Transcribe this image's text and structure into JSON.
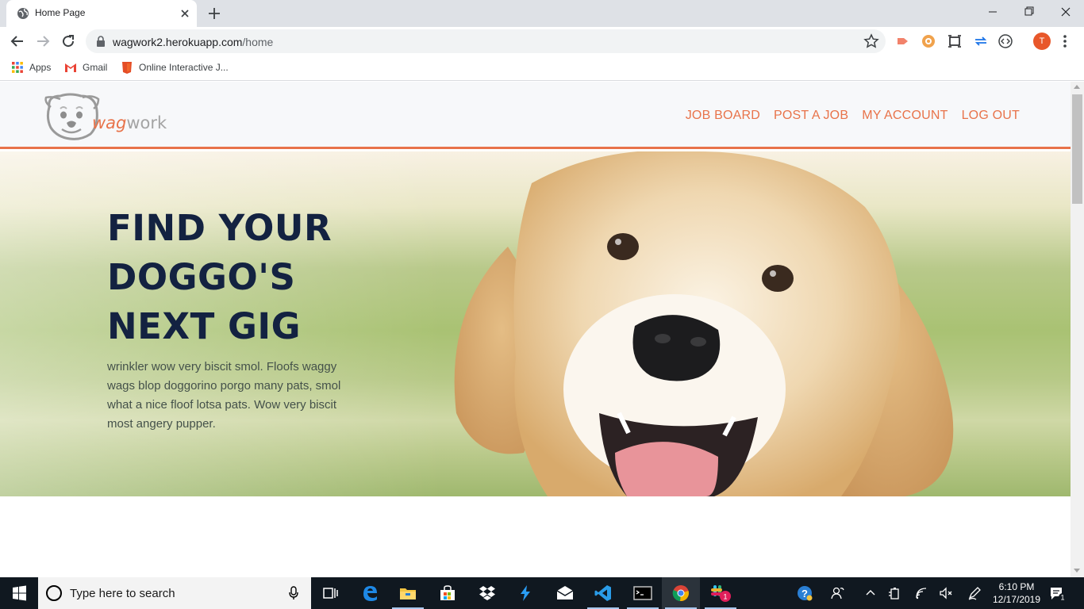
{
  "browser": {
    "tab_title": "Home Page",
    "url_host": "wagwork2.herokuapp.com",
    "url_path": "/home",
    "profile_initial": "T",
    "bookmarks": [
      {
        "label": "Apps",
        "icon": "apps-grid-icon"
      },
      {
        "label": "Gmail",
        "icon": "gmail-icon"
      },
      {
        "label": "Online Interactive J...",
        "icon": "html5-icon"
      }
    ]
  },
  "site": {
    "logo_wag": "wag",
    "logo_work": "work",
    "nav": [
      "JOB BOARD",
      "POST A JOB",
      "MY ACCOUNT",
      "LOG OUT"
    ],
    "hero_title": "FIND YOUR DOGGO'S NEXT GIG",
    "hero_text": "wrinkler wow very biscit smol. Floofs waggy wags blop doggorino porgo many pats, smol what a nice floof lotsa pats. Wow very biscit most angery pupper.",
    "accent_color": "#e8734a",
    "title_color": "#132241"
  },
  "taskbar": {
    "search_placeholder": "Type here to search",
    "time": "6:10 PM",
    "date": "12/17/2019",
    "slack_badge": "1",
    "notification_count": "1"
  }
}
